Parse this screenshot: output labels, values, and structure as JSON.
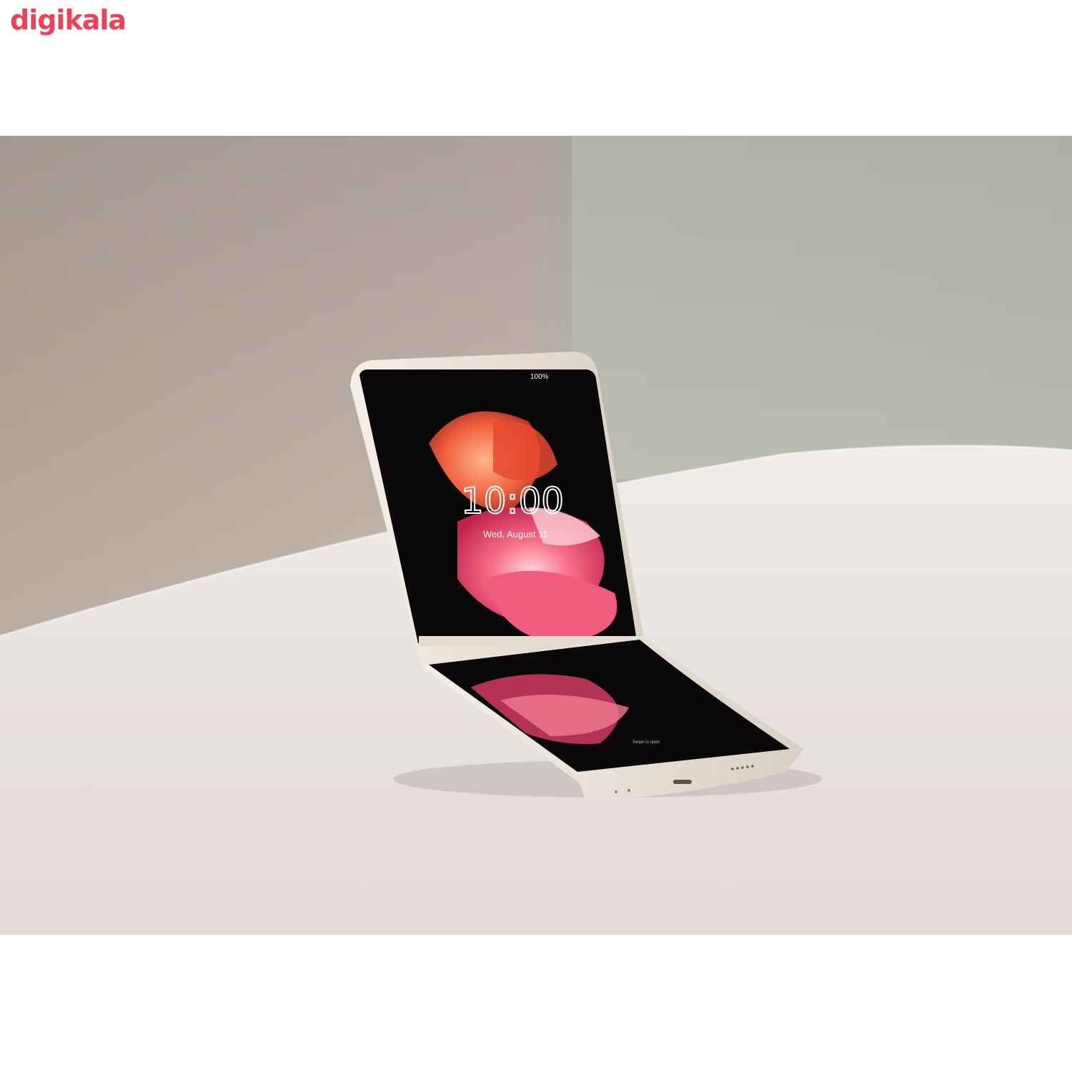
{
  "brand": {
    "logo_text": "digikala",
    "logo_color": "#ef4056"
  },
  "photo": {
    "subject": "foldable-phone-on-table",
    "colors": {
      "wall_left": "#b7aaa1",
      "wall_right": "#b3b7a8",
      "table": "#ece6e4",
      "phone_frame": "#efe7dc",
      "screen": "#0b0809",
      "flower_pink": "#f2536f",
      "flower_orange": "#f26a45"
    },
    "phone_screen": {
      "status": "100%",
      "time": "10:00",
      "date": "Wed, August 11",
      "footer_hint": "Swipe to open"
    }
  }
}
